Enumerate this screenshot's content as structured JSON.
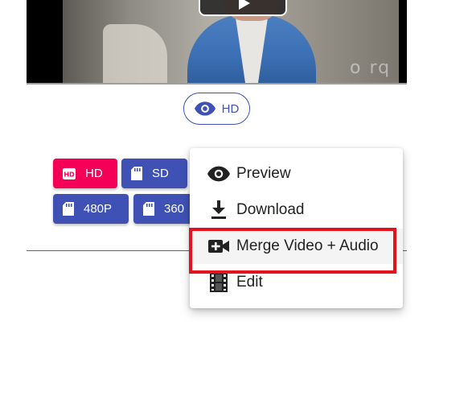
{
  "video": {
    "watermark": "o rq"
  },
  "quality_chip": {
    "label": "HD",
    "icon": "eye-icon"
  },
  "quality_buttons": [
    {
      "label": "HD",
      "icon": "hd-icon",
      "color": "#f50057"
    },
    {
      "label": "SD",
      "icon": "sd-card-icon",
      "color": "#3f51b5"
    },
    {
      "label": "480P",
      "icon": "sd-card-icon",
      "color": "#3f51b5"
    },
    {
      "label": "360",
      "icon": "sd-card-icon",
      "color": "#3f51b5"
    }
  ],
  "menu": {
    "items": [
      {
        "label": "Preview",
        "icon": "eye-icon"
      },
      {
        "label": "Download",
        "icon": "download-icon"
      },
      {
        "label": "Merge Video + Audio",
        "icon": "video-add-icon",
        "highlighted": true
      },
      {
        "label": "Edit",
        "icon": "film-icon"
      }
    ]
  },
  "colors": {
    "accent": "#3f51b5",
    "hd_button": "#f50057",
    "highlight_outline": "#e3131b",
    "divider": "#2e8b1e"
  }
}
